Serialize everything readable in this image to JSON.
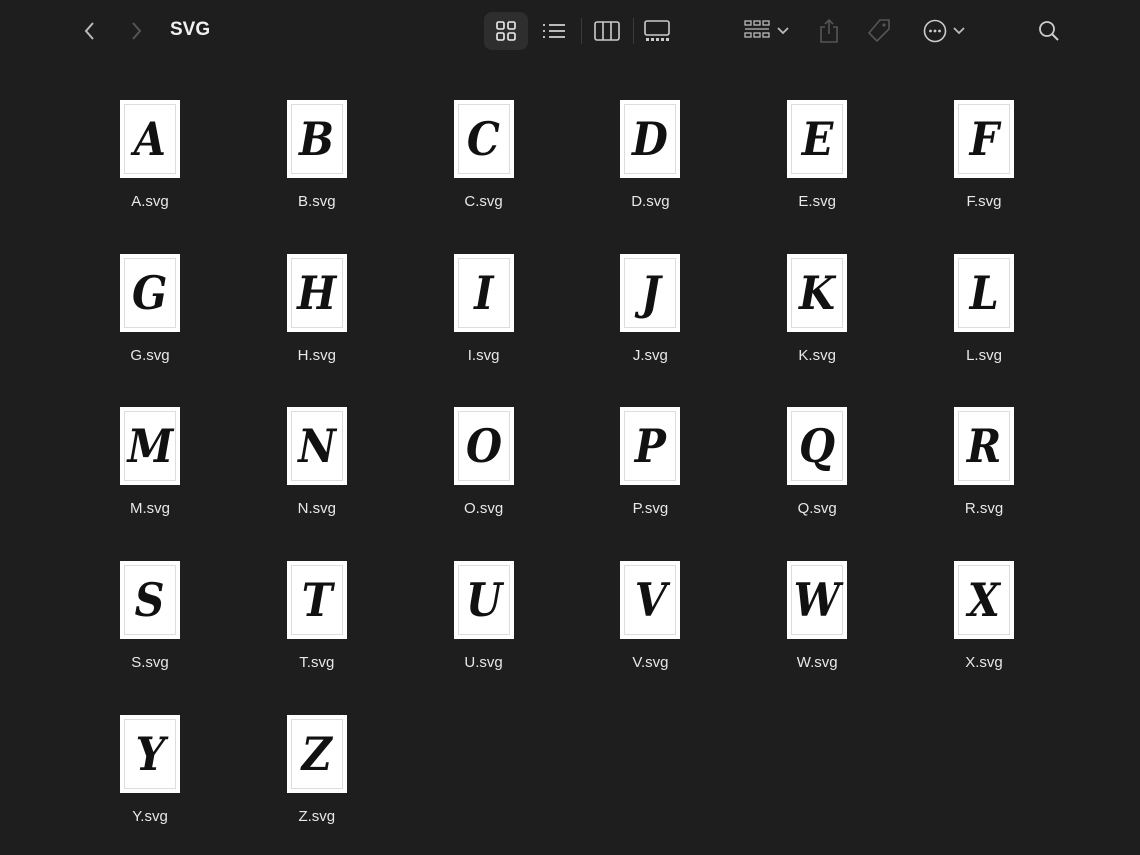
{
  "toolbar": {
    "title": "SVG"
  },
  "files": [
    {
      "name": "A.svg",
      "letter": "A"
    },
    {
      "name": "B.svg",
      "letter": "B"
    },
    {
      "name": "C.svg",
      "letter": "C"
    },
    {
      "name": "D.svg",
      "letter": "D"
    },
    {
      "name": "E.svg",
      "letter": "E"
    },
    {
      "name": "F.svg",
      "letter": "F"
    },
    {
      "name": "G.svg",
      "letter": "G"
    },
    {
      "name": "H.svg",
      "letter": "H"
    },
    {
      "name": "I.svg",
      "letter": "I"
    },
    {
      "name": "J.svg",
      "letter": "J"
    },
    {
      "name": "K.svg",
      "letter": "K"
    },
    {
      "name": "L.svg",
      "letter": "L"
    },
    {
      "name": "M.svg",
      "letter": "M"
    },
    {
      "name": "N.svg",
      "letter": "N"
    },
    {
      "name": "O.svg",
      "letter": "O"
    },
    {
      "name": "P.svg",
      "letter": "P"
    },
    {
      "name": "Q.svg",
      "letter": "Q"
    },
    {
      "name": "R.svg",
      "letter": "R"
    },
    {
      "name": "S.svg",
      "letter": "S"
    },
    {
      "name": "T.svg",
      "letter": "T"
    },
    {
      "name": "U.svg",
      "letter": "U"
    },
    {
      "name": "V.svg",
      "letter": "V"
    },
    {
      "name": "W.svg",
      "letter": "W"
    },
    {
      "name": "X.svg",
      "letter": "X"
    },
    {
      "name": "Y.svg",
      "letter": "Y"
    },
    {
      "name": "Z.svg",
      "letter": "Z"
    }
  ]
}
